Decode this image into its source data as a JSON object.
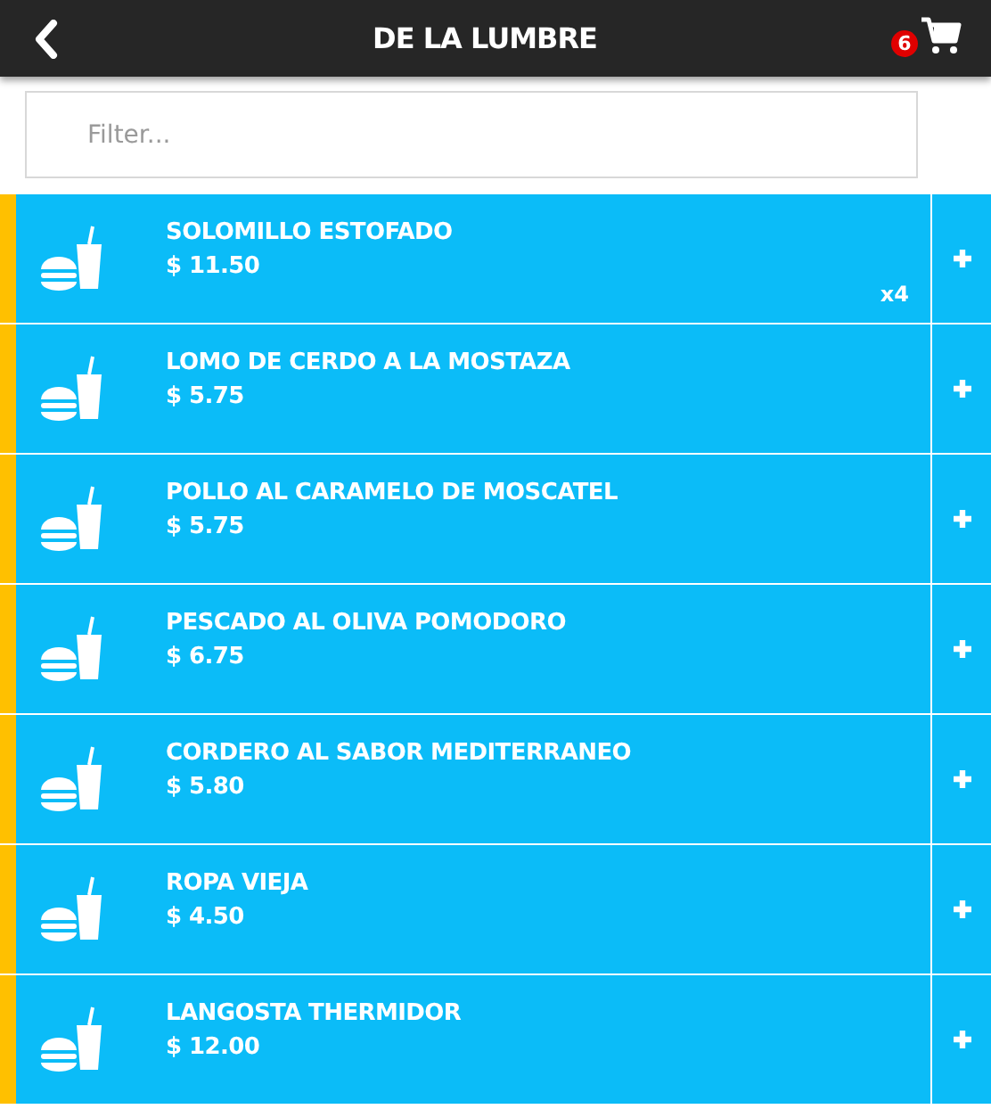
{
  "header": {
    "title": "DE LA LUMBRE",
    "cart_count": "6"
  },
  "filter": {
    "placeholder": "Filter..."
  },
  "items": [
    {
      "name": "SOLOMILLO ESTOFADO",
      "price": "$ 11.50",
      "quantity": "x4"
    },
    {
      "name": "LOMO DE CERDO A LA MOSTAZA",
      "price": "$ 5.75"
    },
    {
      "name": "POLLO AL CARAMELO DE MOSCATEL",
      "price": "$ 5.75"
    },
    {
      "name": "PESCADO AL OLIVA POMODORO",
      "price": "$ 6.75"
    },
    {
      "name": "CORDERO AL SABOR MEDITERRANEO",
      "price": "$ 5.80"
    },
    {
      "name": "ROPA VIEJA",
      "price": "$ 4.50"
    },
    {
      "name": "LANGOSTA THERMIDOR",
      "price": "$ 12.00"
    }
  ]
}
